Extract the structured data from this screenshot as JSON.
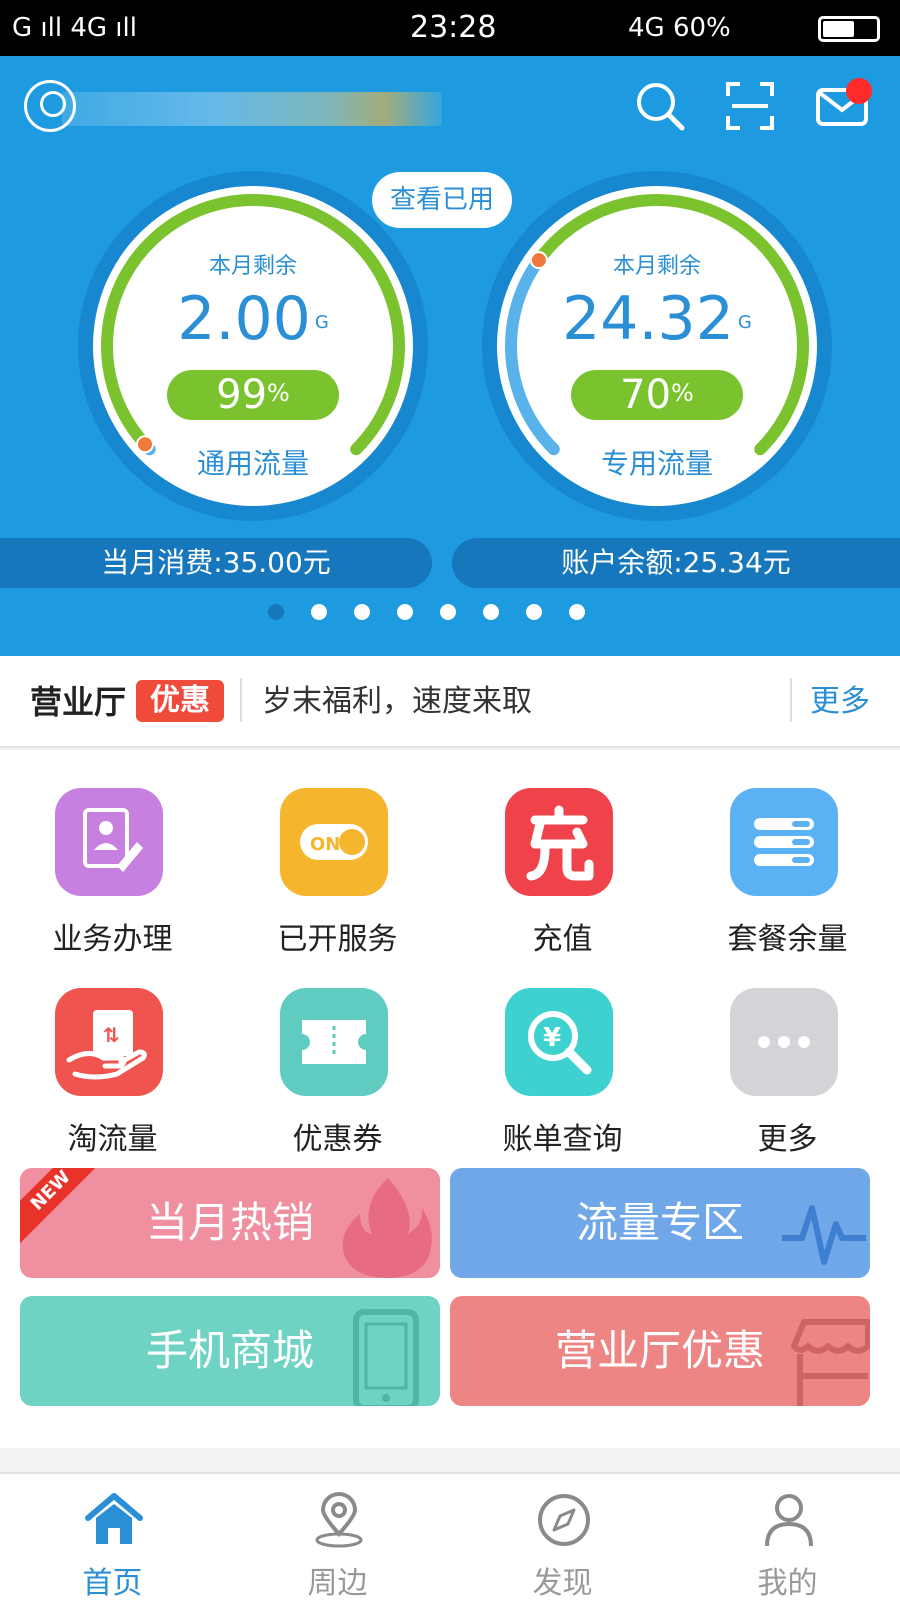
{
  "status_bar": {
    "left": "G ıll 4G ıll",
    "time": "23:28",
    "right": "4G 60%",
    "battery_percent": 60
  },
  "header": {
    "icons": [
      "user-avatar-icon",
      "search-icon",
      "scan-icon",
      "mail-icon"
    ],
    "has_unread_mail": true
  },
  "gauges": {
    "view_used_label": "查看已用",
    "general": {
      "top_label": "本月剩余",
      "value": "2.00",
      "unit": "G",
      "percent": "99",
      "percent_sign": "%",
      "name": "通用流量",
      "remaining_fraction": 0.99
    },
    "special": {
      "top_label": "本月剩余",
      "value": "24.32",
      "unit": "G",
      "percent": "70",
      "percent_sign": "%",
      "name": "专用流量",
      "remaining_fraction": 0.7
    }
  },
  "summary": {
    "monthly_spend": "当月消费:35.00元",
    "balance": "账户余额:25.34元"
  },
  "carousel": {
    "page_count": 8,
    "active_index": 0
  },
  "promo": {
    "brand": "营业厅",
    "tag": "优惠",
    "text": "岁末福利，速度来取",
    "more": "更多"
  },
  "grid": [
    {
      "label": "业务办理",
      "icon": "business-doc-icon",
      "color": "#c77fe0"
    },
    {
      "label": "已开服务",
      "icon": "service-on-icon",
      "color": "#f5b52c"
    },
    {
      "label": "充值",
      "icon": "recharge-icon",
      "color": "#f0424b"
    },
    {
      "label": "套餐余量",
      "icon": "plan-list-icon",
      "color": "#5ab2f5"
    },
    {
      "label": "淘流量",
      "icon": "data-gift-icon",
      "color": "#f0544f"
    },
    {
      "label": "优惠券",
      "icon": "coupon-icon",
      "color": "#5fcbc1"
    },
    {
      "label": "账单查询",
      "icon": "bill-search-icon",
      "color": "#3dd1d0"
    },
    {
      "label": "更多",
      "icon": "more-dots-icon",
      "color": "#d4d4d8"
    }
  ],
  "tiles": {
    "hot": {
      "label": "当月热销",
      "badge": "NEW",
      "color": "#f08fa0"
    },
    "data_zone": {
      "label": "流量专区",
      "color": "#6fa7e8"
    },
    "mall": {
      "label": "手机商城",
      "color": "#6fd3c4"
    },
    "hall": {
      "label": "营业厅优惠",
      "color": "#ee8585"
    }
  },
  "tabs": [
    {
      "label": "首页",
      "icon": "home-icon",
      "active": true
    },
    {
      "label": "周边",
      "icon": "location-icon",
      "active": false
    },
    {
      "label": "发现",
      "icon": "compass-icon",
      "active": false
    },
    {
      "label": "我的",
      "icon": "profile-icon",
      "active": false
    }
  ],
  "colors": {
    "primary_blue": "#1e9be0",
    "accent_green": "#7ac22e",
    "link_blue": "#2b8fd6"
  }
}
